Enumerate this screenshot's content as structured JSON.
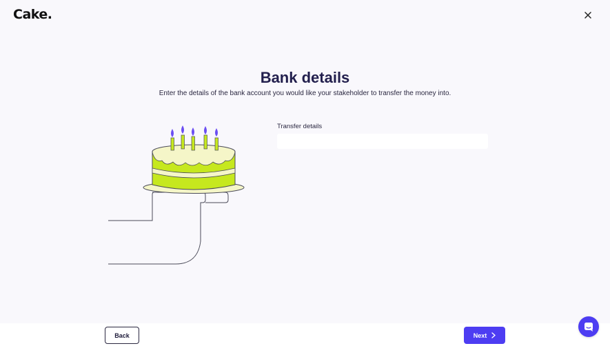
{
  "header": {
    "logo_text": "Cake.",
    "close_icon": "close-icon"
  },
  "main": {
    "title": "Bank details",
    "subtitle": "Enter the details of the bank account you would like your stakeholder to transfer the money into.",
    "field": {
      "label": "Transfer details",
      "value": "",
      "placeholder": ""
    },
    "illustration": "cake-on-hand-illustration"
  },
  "footer": {
    "back_label": "Back",
    "next_label": "Next",
    "next_icon": "chevron-right-icon",
    "chat_icon": "chat-icon"
  },
  "colors": {
    "accent": "#4d3df2",
    "cake_green": "#c6e81e",
    "cream": "#f5f6c8",
    "candle_flame": "#6b4ef2"
  }
}
